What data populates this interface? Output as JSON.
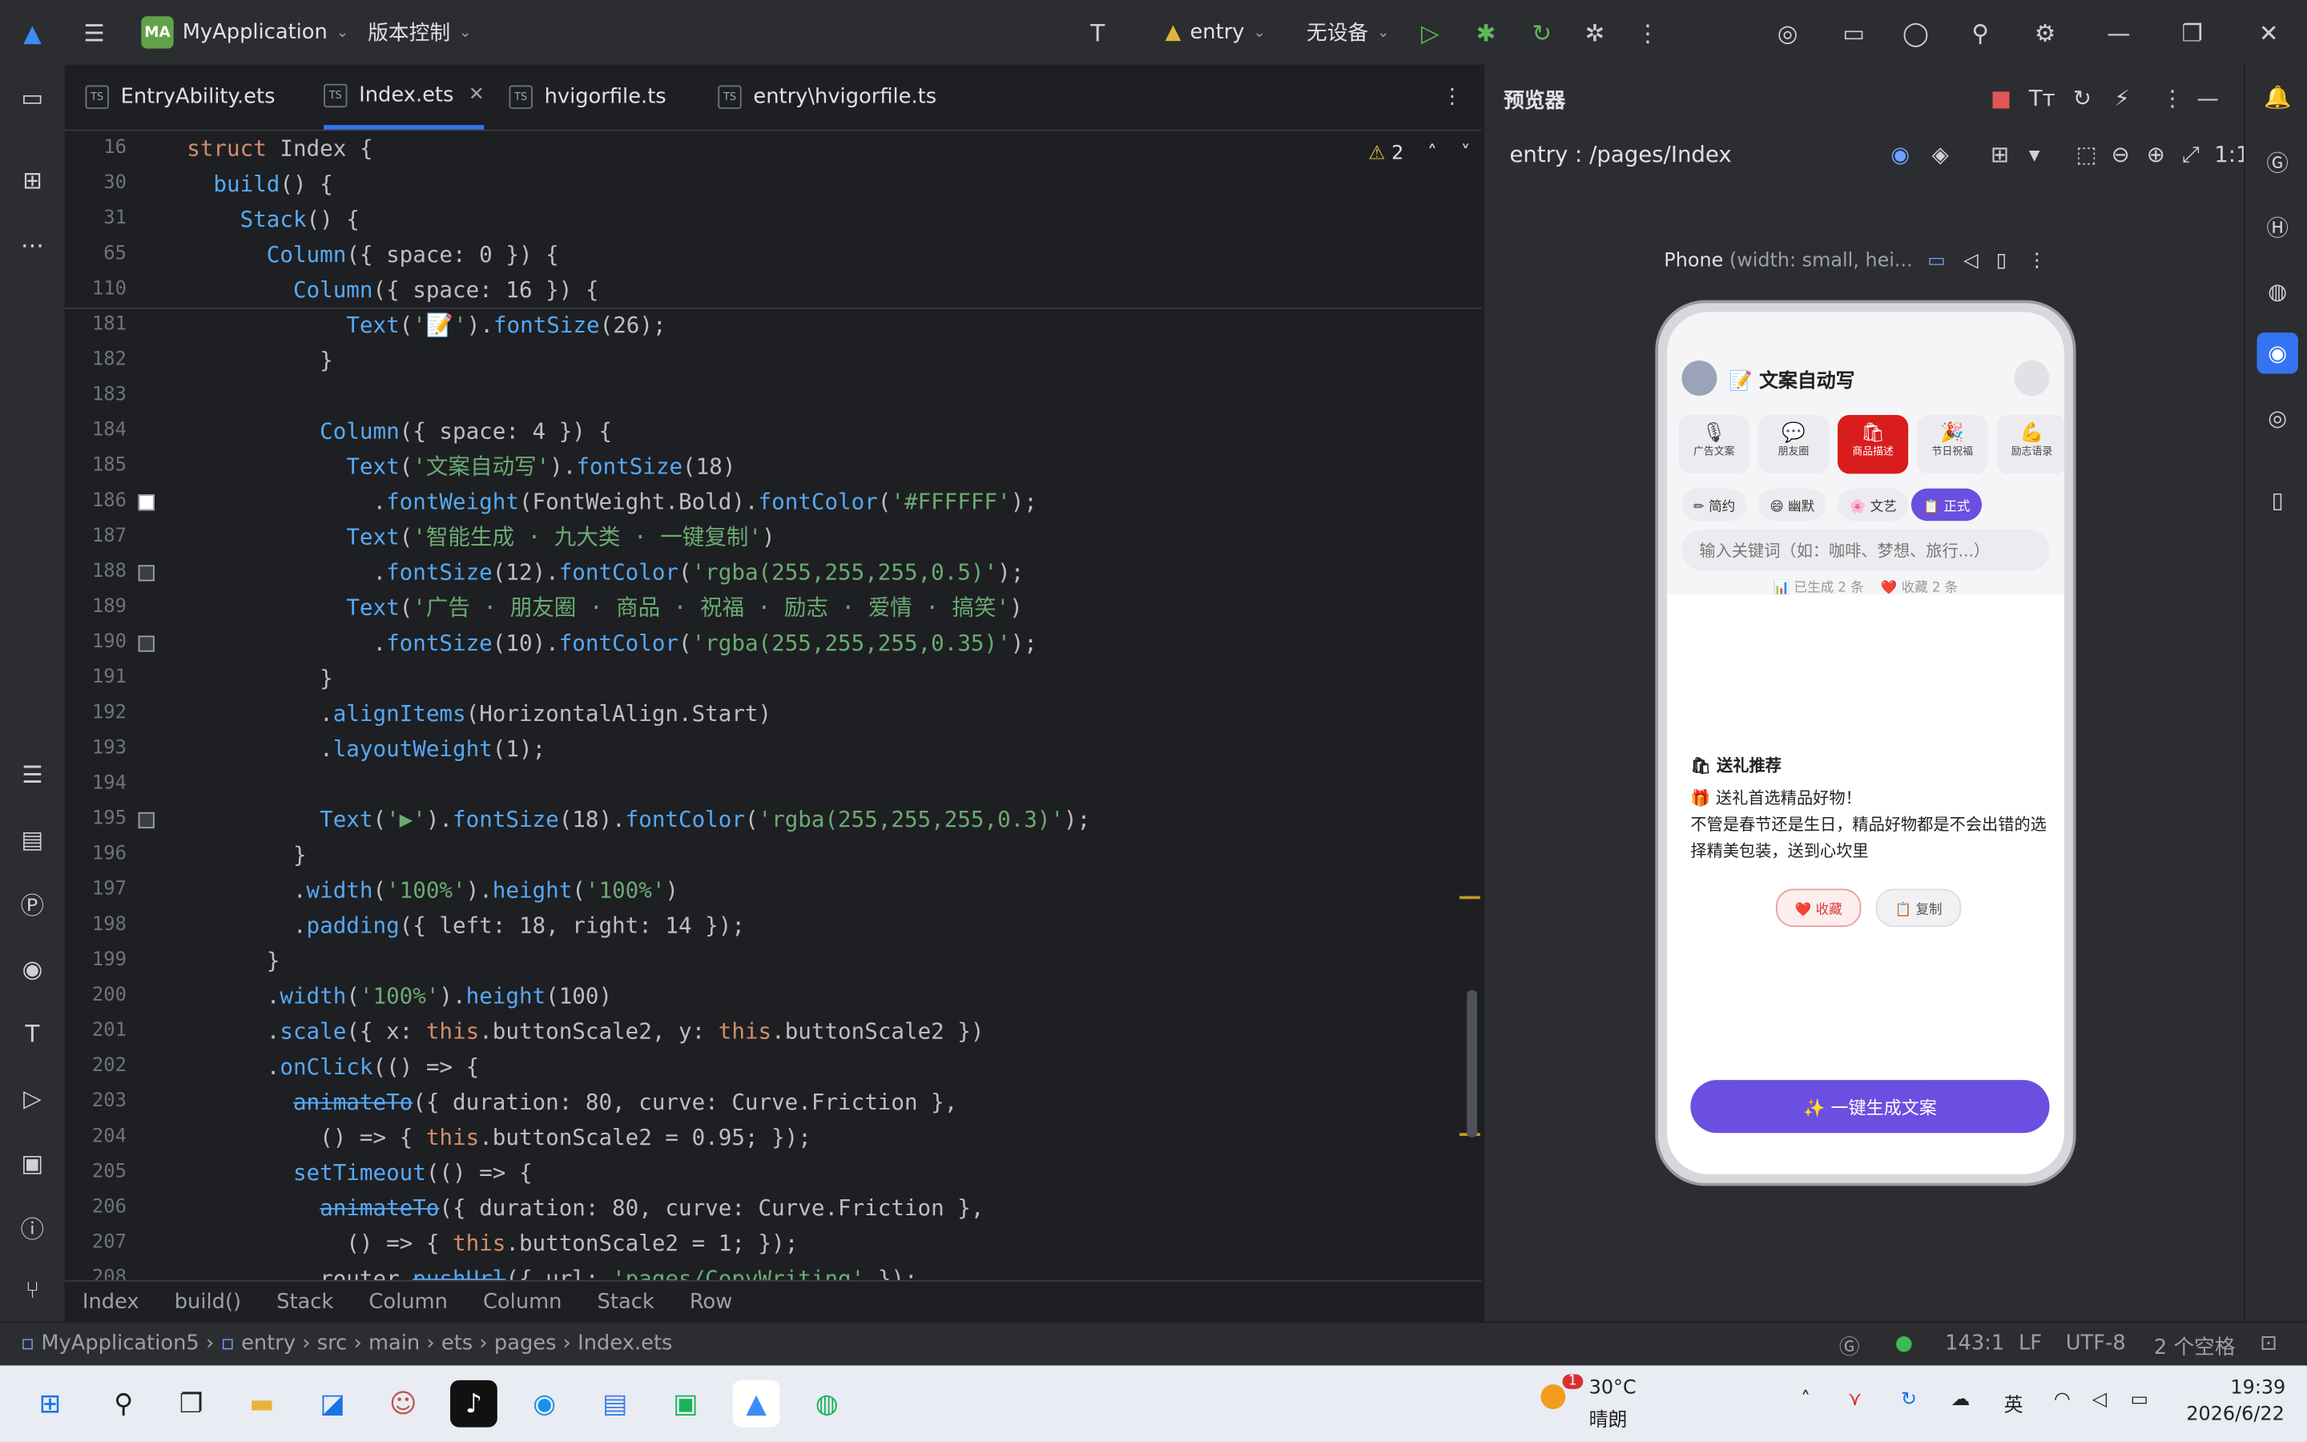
{
  "titlebar": {
    "project_badge": "MA",
    "project_name": "MyApplication",
    "vcs": "版本控制",
    "run_config": "entry",
    "device": "无设备"
  },
  "tabs": [
    {
      "label": "EntryAbility.ets"
    },
    {
      "label": "Index.ets"
    },
    {
      "label": "hvigorfile.ts"
    },
    {
      "label": "entry\\hvigorfile.ts"
    }
  ],
  "editor": {
    "warning_count": "2",
    "sticky": [
      {
        "ln": "16",
        "code": "struct Index {"
      },
      {
        "ln": "30",
        "code": "  build() {"
      },
      {
        "ln": "31",
        "code": "    Stack() {"
      },
      {
        "ln": "65",
        "code": "      Column({ space: 0 }) {"
      },
      {
        "ln": "110",
        "code": "        Column({ space: 16 }) {"
      }
    ],
    "lines": [
      {
        "ln": "181",
        "code": "            Text('📝').fontSize(26);",
        "mark": ""
      },
      {
        "ln": "182",
        "code": "          }",
        "mark": ""
      },
      {
        "ln": "183",
        "code": "",
        "mark": ""
      },
      {
        "ln": "184",
        "code": "          Column({ space: 4 }) {",
        "mark": ""
      },
      {
        "ln": "185",
        "code": "            Text('文案自动写').fontSize(18)",
        "mark": ""
      },
      {
        "ln": "186",
        "code": "              .fontWeight(FontWeight.Bold).fontColor('#FFFFFF');",
        "mark": "white"
      },
      {
        "ln": "187",
        "code": "            Text('智能生成 · 九大类 · 一键复制')",
        "mark": ""
      },
      {
        "ln": "188",
        "code": "              .fontSize(12).fontColor('rgba(255,255,255,0.5)');",
        "mark": "grey"
      },
      {
        "ln": "189",
        "code": "            Text('广告 · 朋友圈 · 商品 · 祝福 · 励志 · 爱情 · 搞笑')",
        "mark": ""
      },
      {
        "ln": "190",
        "code": "              .fontSize(10).fontColor('rgba(255,255,255,0.35)');",
        "mark": "grey"
      },
      {
        "ln": "191",
        "code": "          }",
        "mark": ""
      },
      {
        "ln": "192",
        "code": "          .alignItems(HorizontalAlign.Start)",
        "mark": ""
      },
      {
        "ln": "193",
        "code": "          .layoutWeight(1);",
        "mark": ""
      },
      {
        "ln": "194",
        "code": "",
        "mark": ""
      },
      {
        "ln": "195",
        "code": "          Text('▶').fontSize(18).fontColor('rgba(255,255,255,0.3)');",
        "mark": "grey"
      },
      {
        "ln": "196",
        "code": "        }",
        "mark": ""
      },
      {
        "ln": "197",
        "code": "        .width('100%').height('100%')",
        "mark": ""
      },
      {
        "ln": "198",
        "code": "        .padding({ left: 18, right: 14 });",
        "mark": ""
      },
      {
        "ln": "199",
        "code": "      }",
        "mark": ""
      },
      {
        "ln": "200",
        "code": "      .width('100%').height(100)",
        "mark": ""
      },
      {
        "ln": "201",
        "code": "      .scale({ x: this.buttonScale2, y: this.buttonScale2 })",
        "mark": ""
      },
      {
        "ln": "202",
        "code": "      .onClick(() => {",
        "mark": ""
      },
      {
        "ln": "203",
        "code": "        animateTo({ duration: 80, curve: Curve.Friction },",
        "mark": ""
      },
      {
        "ln": "204",
        "code": "          () => { this.buttonScale2 = 0.95; });",
        "mark": ""
      },
      {
        "ln": "205",
        "code": "        setTimeout(() => {",
        "mark": ""
      },
      {
        "ln": "206",
        "code": "          animateTo({ duration: 80, curve: Curve.Friction },",
        "mark": ""
      },
      {
        "ln": "207",
        "code": "            () => { this.buttonScale2 = 1; });",
        "mark": ""
      },
      {
        "ln": "208",
        "code": "          router.pushUrl({ url: 'pages/CopyWriting' });",
        "mark": ""
      }
    ]
  },
  "breadcrumb": [
    "Index",
    "build()",
    "Stack",
    "Column",
    "Column",
    "Stack",
    "Row"
  ],
  "preview": {
    "title": "预览器",
    "path": "entry : /pages/Index",
    "ratio": "1:1",
    "device_name": "Phone",
    "device_spec": "(width: small, hei...",
    "app": {
      "title": "📝 文案自动写",
      "categories": [
        {
          "emoji": "🎙",
          "label": "广告文案"
        },
        {
          "emoji": "💬",
          "label": "朋友圈"
        },
        {
          "emoji": "🛍",
          "label": "商品描述"
        },
        {
          "emoji": "🎉",
          "label": "节日祝福"
        },
        {
          "emoji": "💪",
          "label": "励志语录"
        }
      ],
      "styles": [
        "✏ 简约",
        "😄 幽默",
        "🌸 文艺",
        "📋 正式"
      ],
      "input_placeholder": "输入关键词（如：咖啡、梦想、旅行...）",
      "stats_generated": "📊 已生成 2 条",
      "stats_fav": "❤️ 收藏 2 条",
      "card_title": "🛍 送礼推荐",
      "card_line1": "🎁 送礼首选精品好物！",
      "card_line2": "不管是春节还是生日，精品好物都是不会出错的选择精美包装，送到心坎里",
      "fav_btn": "❤️ 收藏",
      "copy_btn": "📋 复制",
      "generate_btn": "✨ 一键生成文案"
    }
  },
  "statusbar": {
    "path": [
      "MyApplication5",
      "entry",
      "src",
      "main",
      "ets",
      "pages",
      "Index.ets"
    ],
    "position": "143:1",
    "line_sep": "LF",
    "encoding": "UTF-8",
    "indent": "2 个空格"
  },
  "taskbar": {
    "weather_badge": "1",
    "temp": "30°C",
    "weather": "晴朗",
    "ime": "英",
    "time": "19:39",
    "date": "2026/6/22"
  }
}
